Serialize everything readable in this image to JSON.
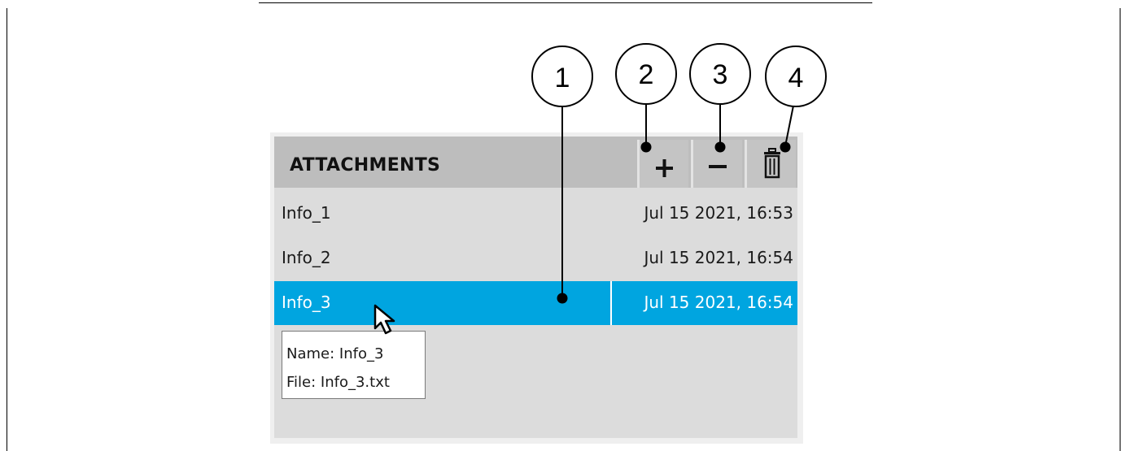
{
  "callouts": [
    "1",
    "2",
    "3",
    "4"
  ],
  "panel": {
    "title": "ATTACHMENTS",
    "toolbar": [
      {
        "action": "add",
        "icon": "plus-icon"
      },
      {
        "action": "remove",
        "icon": "minus-icon"
      },
      {
        "action": "delete-all",
        "icon": "trash-icon"
      }
    ],
    "rows": [
      {
        "name": "Info_1",
        "date": "Jul 15 2021, 16:53",
        "selected": false
      },
      {
        "name": "Info_2",
        "date": "Jul 15 2021, 16:54",
        "selected": false
      },
      {
        "name": "Info_3",
        "date": "Jul 15 2021, 16:54",
        "selected": true
      }
    ],
    "tooltip": {
      "name_line": "Name: Info_3",
      "file_line": "File: Info_3.txt"
    }
  },
  "colors": {
    "selection": "#00a5e0",
    "header": "#bdbdbd",
    "panel_background": "#dcdcdc"
  }
}
